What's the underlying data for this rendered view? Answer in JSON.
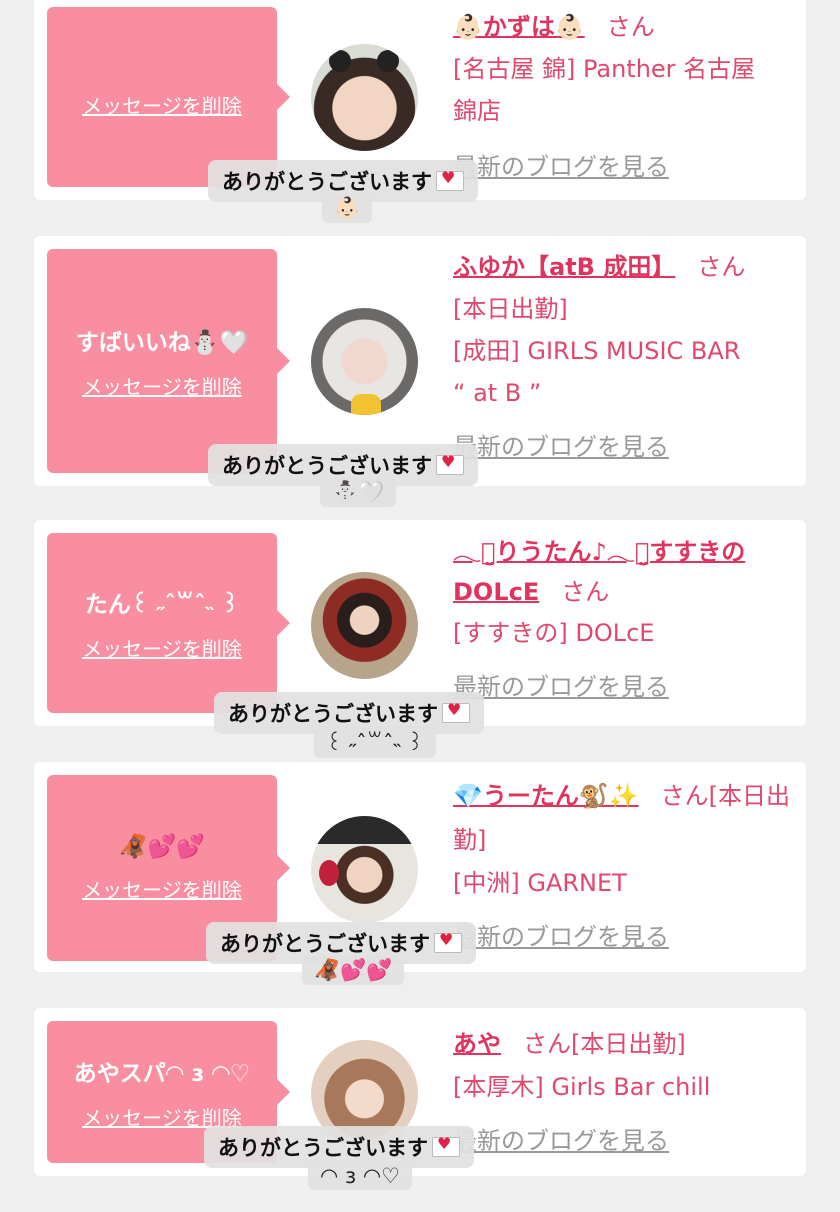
{
  "colors": {
    "bubble": "#f98ea0",
    "name": "#e0345f",
    "info": "#e0486e",
    "blog": "#999999",
    "background": "#efefef"
  },
  "common": {
    "delete_label": "メッセージを削除",
    "blog_label": "最新のブログを見る",
    "san": "さん",
    "thanks": "ありがとうございます"
  },
  "cards": [
    {
      "reply": "",
      "name": "👶🏻かずは👶🏻",
      "after_san": "",
      "lines": [
        "[名古屋 錦] Panther 名古屋",
        "錦店"
      ],
      "toast_sub": "👶🏻"
    },
    {
      "reply": "すばいいね⛄️🤍",
      "name": "ふゆか【atB 成田】",
      "after_san": "",
      "lines": [
        "[本日出勤]",
        "[成田] GIRLS MUSIC BAR",
        "“ at B ”"
      ],
      "toast_sub": "⛄️🤍"
    },
    {
      "reply": "たん꒰ ˶ˆ꒳ˆ˵ ꒱",
      "name": "𓂃ꪔ̤̮りうたん♪𓂃ꪔ̤̮すすきのDOLcE",
      "after_san": "",
      "lines": [
        "[すすきの] DOLcE"
      ],
      "toast_sub": "꒰ ˶ˆ꒳ˆ˵ ꒱"
    },
    {
      "reply": "🦧💕💕",
      "name": "💎うーたん🐒✨",
      "after_san": "[本日出勤]",
      "lines": [
        "[中洲] GARNET"
      ],
      "toast_sub": "🦧💕💕"
    },
    {
      "reply": "あやスパ◠ ɜ ◠♡",
      "name": "あや",
      "after_san": "[本日出勤]",
      "lines": [
        "[本厚木] Girls Bar chill"
      ],
      "toast_sub": "◠ ɜ ◠♡"
    }
  ]
}
